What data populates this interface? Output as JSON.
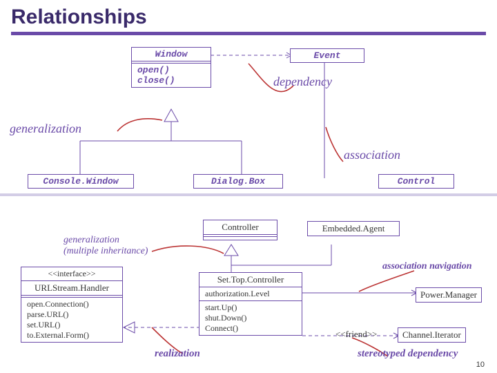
{
  "title": "Relationships",
  "boxes": {
    "window": {
      "name": "Window",
      "ops": "open()\nclose()"
    },
    "event": {
      "name": "Event"
    },
    "consoleWindow": {
      "name": "Console.Window"
    },
    "dialogBox": {
      "name": "Dialog.Box"
    },
    "control": {
      "name": "Control"
    },
    "controller": {
      "name": "Controller"
    },
    "embeddedAgent": {
      "name": "Embedded.Agent"
    },
    "urlHandler": {
      "stereotype": "<<interface>>",
      "name": "URLStream.Handler",
      "ops": "open.Connection()\nparse.URL()\nset.URL()\nto.External.Form()"
    },
    "setTopController": {
      "name": "Set.Top.Controller",
      "prop": "authorization.Level",
      "ops": "start.Up()\nshut.Down()\nConnect()"
    },
    "powerManager": {
      "name": "Power.Manager"
    },
    "channelIterator": {
      "name": "Channel.Iterator"
    }
  },
  "labels": {
    "generalization": "generalization",
    "dependency": "dependency",
    "association": "association",
    "genMulti": "generalization\n(multiple inheritance)",
    "assocNav": "association navigation",
    "realization": "realization",
    "stereoDep": "stereotyped dependency",
    "friend": "<<friend>>"
  },
  "page": "10"
}
